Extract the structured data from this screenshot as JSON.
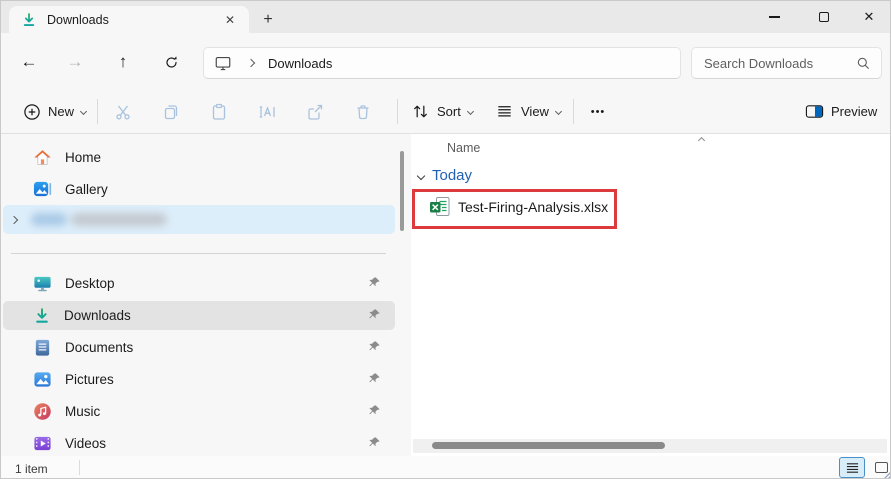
{
  "window": {
    "tab_title": "Downloads",
    "app": "File Explorer"
  },
  "glyphs": {
    "tab_close": "✕",
    "new_tab": "+",
    "window_close": "✕",
    "back": "←",
    "forward": "→",
    "up": "↑",
    "more": "•••"
  },
  "nav": {
    "location": "Downloads",
    "search_placeholder": "Search Downloads"
  },
  "toolbar": {
    "new_label": "New",
    "sort_label": "Sort",
    "view_label": "View",
    "preview_label": "Preview"
  },
  "sidebar": {
    "items_top": [
      {
        "label": "Home"
      },
      {
        "label": "Gallery"
      }
    ],
    "items_pinned": [
      {
        "label": "Desktop",
        "pinned": true
      },
      {
        "label": "Downloads",
        "pinned": true,
        "selected": true
      },
      {
        "label": "Documents",
        "pinned": true
      },
      {
        "label": "Pictures",
        "pinned": true
      },
      {
        "label": "Music",
        "pinned": true
      },
      {
        "label": "Videos",
        "pinned": true
      }
    ]
  },
  "main": {
    "column_header": "Name",
    "group_label": "Today",
    "files": [
      {
        "name": "Test-Firing-Analysis.xlsx",
        "type": "xlsx",
        "annotated": true
      }
    ]
  },
  "status_bar": {
    "items_count": "1 item"
  },
  "colors": {
    "accent": "#0067C0",
    "annotation_red": "#DD3A3D",
    "excel_green": "#1A7F47",
    "group_header_blue": "#2160B4",
    "selection_blue": "#DDEEFB",
    "selection_grey": "#E3E3E3"
  }
}
